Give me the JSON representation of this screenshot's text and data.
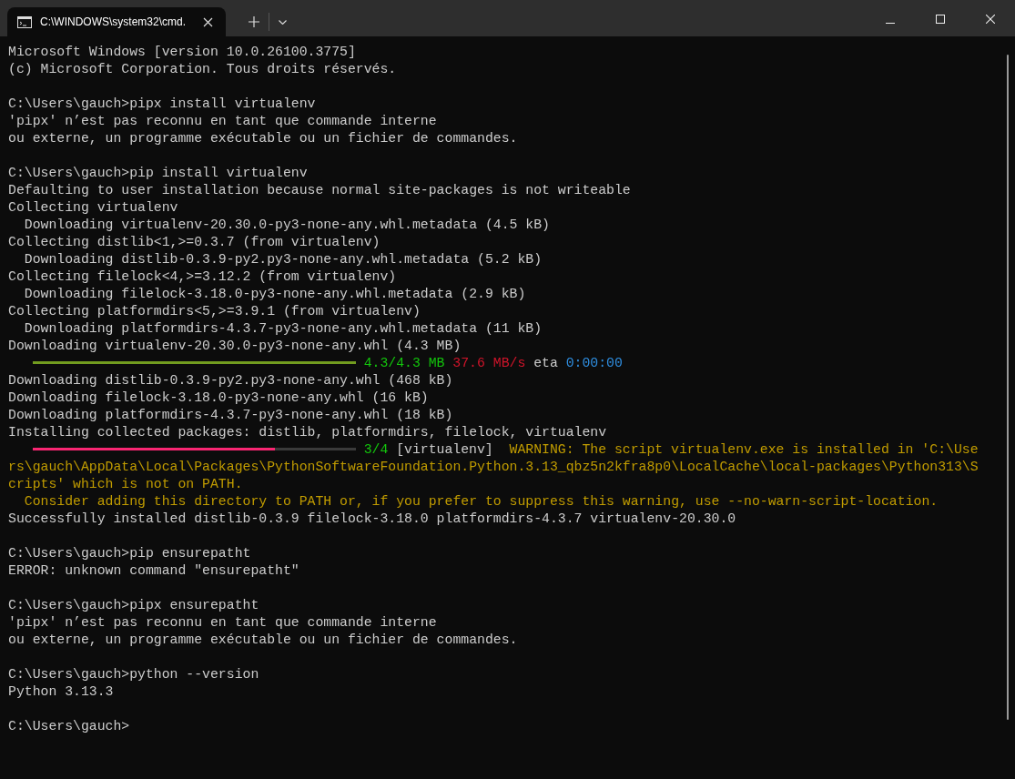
{
  "window": {
    "tab": {
      "title": "C:\\WINDOWS\\system32\\cmd.",
      "selected": true
    }
  },
  "terminal": {
    "lines": [
      {
        "kind": "text",
        "segments": [
          {
            "kind": "plain",
            "text": "Microsoft Windows [version 10.0.26100.3775]"
          }
        ]
      },
      {
        "kind": "text",
        "segments": [
          {
            "kind": "plain",
            "text": "(c) Microsoft Corporation. Tous droits réservés."
          }
        ]
      },
      {
        "kind": "blank"
      },
      {
        "kind": "text",
        "segments": [
          {
            "kind": "plain",
            "text": "C:\\Users\\gauch>pipx install virtualenv"
          }
        ]
      },
      {
        "kind": "text",
        "segments": [
          {
            "kind": "plain",
            "text": "'pipx' n’est pas reconnu en tant que commande interne"
          }
        ]
      },
      {
        "kind": "text",
        "segments": [
          {
            "kind": "plain",
            "text": "ou externe, un programme exécutable ou un fichier de commandes."
          }
        ]
      },
      {
        "kind": "blank"
      },
      {
        "kind": "text",
        "segments": [
          {
            "kind": "plain",
            "text": "C:\\Users\\gauch>pip install virtualenv"
          }
        ]
      },
      {
        "kind": "text",
        "segments": [
          {
            "kind": "plain",
            "text": "Defaulting to user installation because normal site-packages is not writeable"
          }
        ]
      },
      {
        "kind": "text",
        "segments": [
          {
            "kind": "plain",
            "text": "Collecting virtualenv"
          }
        ]
      },
      {
        "kind": "text",
        "segments": [
          {
            "kind": "plain",
            "text": "  Downloading virtualenv-20.30.0-py3-none-any.whl.metadata (4.5 kB)"
          }
        ]
      },
      {
        "kind": "text",
        "segments": [
          {
            "kind": "plain",
            "text": "Collecting distlib<1,>=0.3.7 (from virtualenv)"
          }
        ]
      },
      {
        "kind": "text",
        "segments": [
          {
            "kind": "plain",
            "text": "  Downloading distlib-0.3.9-py2.py3-none-any.whl.metadata (5.2 kB)"
          }
        ]
      },
      {
        "kind": "text",
        "segments": [
          {
            "kind": "plain",
            "text": "Collecting filelock<4,>=3.12.2 (from virtualenv)"
          }
        ]
      },
      {
        "kind": "text",
        "segments": [
          {
            "kind": "plain",
            "text": "  Downloading filelock-3.18.0-py3-none-any.whl.metadata (2.9 kB)"
          }
        ]
      },
      {
        "kind": "text",
        "segments": [
          {
            "kind": "plain",
            "text": "Collecting platformdirs<5,>=3.9.1 (from virtualenv)"
          }
        ]
      },
      {
        "kind": "text",
        "segments": [
          {
            "kind": "plain",
            "text": "  Downloading platformdirs-4.3.7-py3-none-any.whl.metadata (11 kB)"
          }
        ]
      },
      {
        "kind": "text",
        "segments": [
          {
            "kind": "plain",
            "text": "Downloading virtualenv-20.30.0-py3-none-any.whl (4.3 MB)"
          }
        ]
      },
      {
        "kind": "text",
        "segments": [
          {
            "kind": "bar",
            "complete": true,
            "level": 1
          },
          {
            "kind": "green",
            "text": "4.3/4.3 MB"
          },
          {
            "kind": "red",
            "text": " 37.6 MB/s"
          },
          {
            "kind": "plain",
            "text": " eta"
          },
          {
            "kind": "blue",
            "text": " 0:00:00"
          }
        ]
      },
      {
        "kind": "text",
        "segments": [
          {
            "kind": "plain",
            "text": "Downloading distlib-0.3.9-py2.py3-none-any.whl (468 kB)"
          }
        ]
      },
      {
        "kind": "text",
        "segments": [
          {
            "kind": "plain",
            "text": "Downloading filelock-3.18.0-py3-none-any.whl (16 kB)"
          }
        ]
      },
      {
        "kind": "text",
        "segments": [
          {
            "kind": "plain",
            "text": "Downloading platformdirs-4.3.7-py3-none-any.whl (18 kB)"
          }
        ]
      },
      {
        "kind": "text",
        "segments": [
          {
            "kind": "plain",
            "text": "Installing collected packages: distlib, platformdirs, filelock, virtualenv"
          }
        ]
      },
      {
        "kind": "text",
        "segments": [
          {
            "kind": "bar",
            "complete": false,
            "level": 0.75
          },
          {
            "kind": "green",
            "text": "3/4"
          },
          {
            "kind": "plain",
            "text": " [virtualenv]"
          },
          {
            "kind": "yellow",
            "text": "  WARNING: The script virtualenv.exe is installed in 'C:\\Use"
          }
        ]
      },
      {
        "kind": "text",
        "segments": [
          {
            "kind": "yellow",
            "text": "rs\\gauch\\AppData\\Local\\Packages\\PythonSoftwareFoundation.Python.3.13_qbz5n2kfra8p0\\LocalCache\\local-packages\\Python313\\S"
          }
        ]
      },
      {
        "kind": "text",
        "segments": [
          {
            "kind": "yellow",
            "text": "cripts' which is not on PATH."
          }
        ]
      },
      {
        "kind": "text",
        "segments": [
          {
            "kind": "yellow",
            "text": "  Consider adding this directory to PATH or, if you prefer to suppress this warning, use --no-warn-script-location."
          }
        ]
      },
      {
        "kind": "text",
        "segments": [
          {
            "kind": "plain",
            "text": "Successfully installed distlib-0.3.9 filelock-3.18.0 platformdirs-4.3.7 virtualenv-20.30.0"
          }
        ]
      },
      {
        "kind": "blank"
      },
      {
        "kind": "text",
        "segments": [
          {
            "kind": "plain",
            "text": "C:\\Users\\gauch>pip ensurepatht"
          }
        ]
      },
      {
        "kind": "text",
        "segments": [
          {
            "kind": "plain",
            "text": "ERROR: unknown command \"ensurepatht\""
          }
        ]
      },
      {
        "kind": "blank"
      },
      {
        "kind": "text",
        "segments": [
          {
            "kind": "plain",
            "text": "C:\\Users\\gauch>pipx ensurepatht"
          }
        ]
      },
      {
        "kind": "text",
        "segments": [
          {
            "kind": "plain",
            "text": "'pipx' n’est pas reconnu en tant que commande interne"
          }
        ]
      },
      {
        "kind": "text",
        "segments": [
          {
            "kind": "plain",
            "text": "ou externe, un programme exécutable ou un fichier de commandes."
          }
        ]
      },
      {
        "kind": "blank"
      },
      {
        "kind": "text",
        "segments": [
          {
            "kind": "plain",
            "text": "C:\\Users\\gauch>python --version"
          }
        ]
      },
      {
        "kind": "text",
        "segments": [
          {
            "kind": "plain",
            "text": "Python 3.13.3"
          }
        ]
      },
      {
        "kind": "blank"
      },
      {
        "kind": "text",
        "segments": [
          {
            "kind": "plain",
            "text": "C:\\Users\\gauch>"
          }
        ]
      }
    ]
  }
}
